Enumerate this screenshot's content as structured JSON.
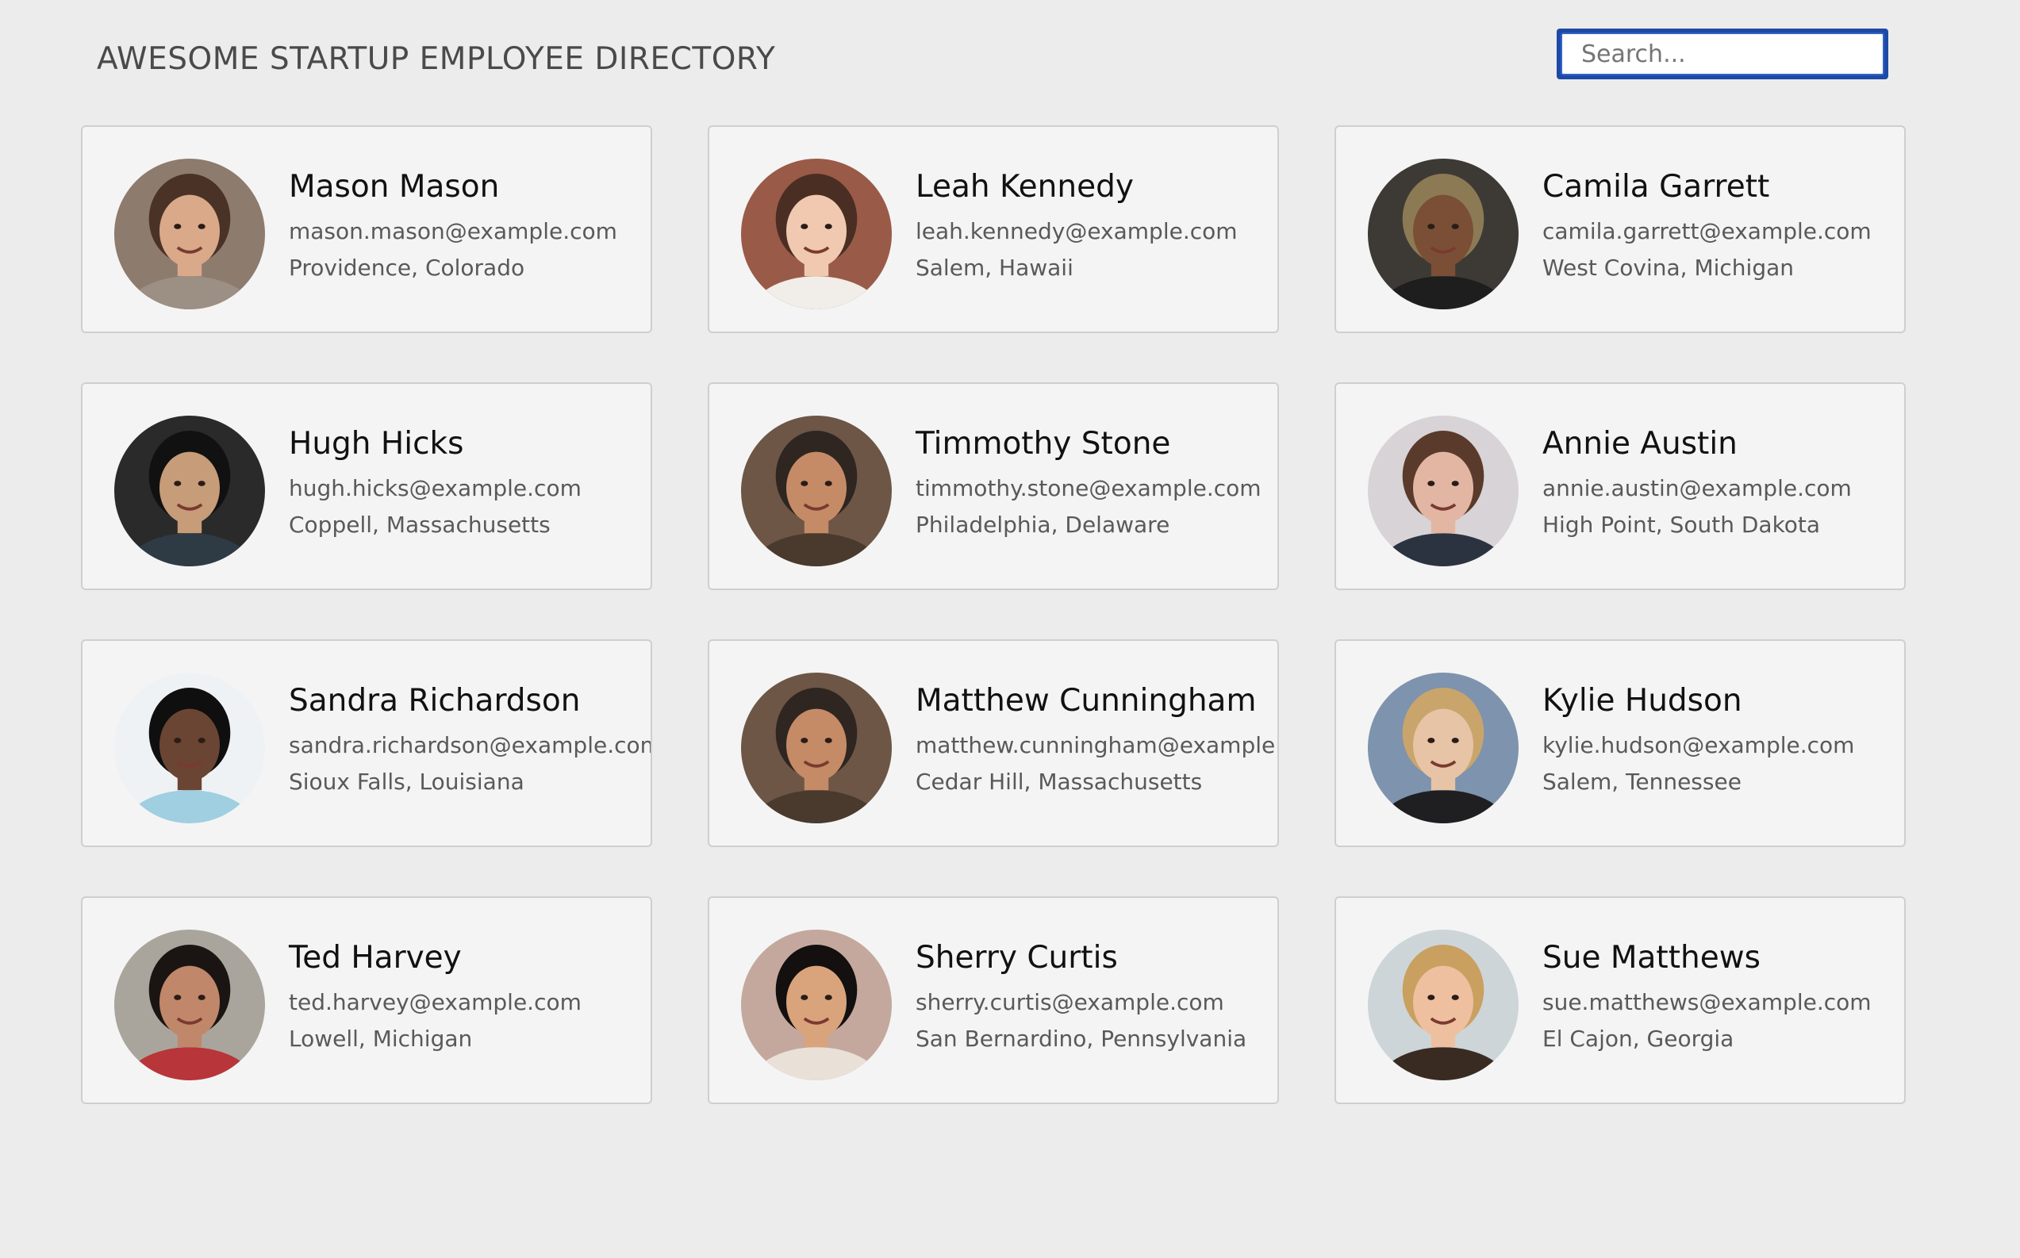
{
  "header": {
    "title": "AWESOME STARTUP EMPLOYEE DIRECTORY",
    "search_placeholder": "Search..."
  },
  "employees": [
    {
      "name": "Mason Mason",
      "email": "mason.mason@example.com",
      "location": "Providence, Colorado",
      "photo": {
        "bg": "#8d7b6e",
        "skin": "#d9a98a",
        "hair": "#4a3326",
        "shirt": "#9c8f84"
      }
    },
    {
      "name": "Leah Kennedy",
      "email": "leah.kennedy@example.com",
      "location": "Salem, Hawaii",
      "photo": {
        "bg": "#9a5a48",
        "skin": "#f0c9b0",
        "hair": "#4b2e23",
        "shirt": "#f1ede8"
      }
    },
    {
      "name": "Camila Garrett",
      "email": "camila.garrett@example.com",
      "location": "West Covina, Michigan",
      "photo": {
        "bg": "#3d3a36",
        "skin": "#7a4f36",
        "hair": "#8c7a55",
        "shirt": "#1e1e1e"
      }
    },
    {
      "name": "Hugh Hicks",
      "email": "hugh.hicks@example.com",
      "location": "Coppell, Massachusetts",
      "photo": {
        "bg": "#2a2a2a",
        "skin": "#c79c79",
        "hair": "#111111",
        "shirt": "#2f3b44"
      }
    },
    {
      "name": "Timmothy Stone",
      "email": "timmothy.stone@example.com",
      "location": "Philadelphia, Delaware",
      "photo": {
        "bg": "#6d5646",
        "skin": "#c58b66",
        "hair": "#2f2621",
        "shirt": "#4a3a2e"
      }
    },
    {
      "name": "Annie Austin",
      "email": "annie.austin@example.com",
      "location": "High Point, South Dakota",
      "photo": {
        "bg": "#d8d3d6",
        "skin": "#e3b6a3",
        "hair": "#5a3a2a",
        "shirt": "#2c3340"
      }
    },
    {
      "name": "Sandra Richardson",
      "email": "sandra.richardson@example.com",
      "location": "Sioux Falls, Louisiana",
      "photo": {
        "bg": "#eef2f5",
        "skin": "#6a4533",
        "hair": "#0f0f0f",
        "shirt": "#9fcfe0"
      }
    },
    {
      "name": "Matthew Cunningham",
      "email": "matthew.cunningham@example.com",
      "location": "Cedar Hill, Massachusetts",
      "photo": {
        "bg": "#6d5646",
        "skin": "#c58b66",
        "hair": "#2f2621",
        "shirt": "#4a3a2e"
      }
    },
    {
      "name": "Kylie Hudson",
      "email": "kylie.hudson@example.com",
      "location": "Salem, Tennessee",
      "photo": {
        "bg": "#7e93ad",
        "skin": "#e7c4a6",
        "hair": "#c9a56c",
        "shirt": "#1f1f22"
      }
    },
    {
      "name": "Ted Harvey",
      "email": "ted.harvey@example.com",
      "location": "Lowell, Michigan",
      "photo": {
        "bg": "#a9a59c",
        "skin": "#c0876a",
        "hair": "#1a1512",
        "shirt": "#b8353a"
      }
    },
    {
      "name": "Sherry Curtis",
      "email": "sherry.curtis@example.com",
      "location": "San Bernardino, Pennsylvania",
      "photo": {
        "bg": "#c4a89e",
        "skin": "#d9a47c",
        "hair": "#141010",
        "shirt": "#e9e0d8"
      }
    },
    {
      "name": "Sue Matthews",
      "email": "sue.matthews@example.com",
      "location": "El Cajon, Georgia",
      "photo": {
        "bg": "#cdd5d8",
        "skin": "#eec0a0",
        "hair": "#c9a060",
        "shirt": "#3a2b22"
      }
    }
  ]
}
